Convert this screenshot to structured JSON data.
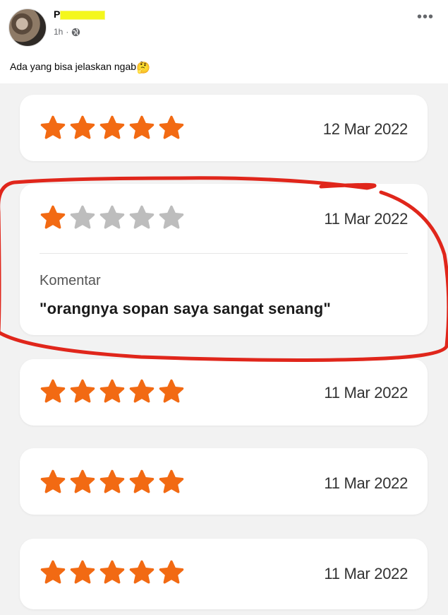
{
  "post": {
    "author_visible": "P",
    "time": "1h",
    "separator": "·",
    "text": "Ada yang bisa jelaskan ngab",
    "emoji": "🤔",
    "more": "•••"
  },
  "reviews": [
    {
      "rating": 5,
      "date": "12 Mar 2022"
    },
    {
      "rating": 1,
      "date": "11 Mar 2022",
      "comment_label": "Komentar",
      "comment": "\"orangnya sopan saya sangat senang\""
    },
    {
      "rating": 5,
      "date": "11 Mar 2022"
    },
    {
      "rating": 5,
      "date": "11 Mar 2022"
    },
    {
      "rating": 5,
      "date": "11 Mar 2022"
    }
  ],
  "colors": {
    "star_filled": "#f26a13",
    "star_empty": "#bdbdbd",
    "annotation": "#e0261b",
    "card_bg": "#ffffff",
    "page_bg": "#f2f2f2"
  },
  "icons": {
    "globe": "globe-icon",
    "more": "more-options-icon",
    "avatar": "avatar"
  }
}
